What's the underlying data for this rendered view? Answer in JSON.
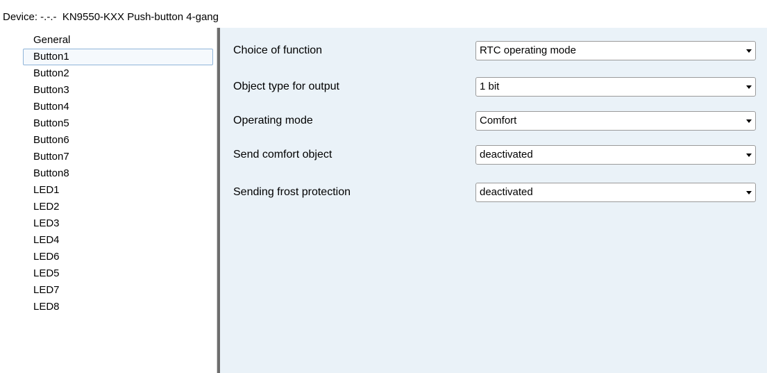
{
  "window": {
    "title": "Device: -.-.-  KN9550-KXX Push-button 4-gang"
  },
  "sidebar": {
    "items": [
      {
        "label": "General"
      },
      {
        "label": "Button1",
        "selected": true
      },
      {
        "label": "Button2"
      },
      {
        "label": "Button3"
      },
      {
        "label": "Button4"
      },
      {
        "label": "Button5"
      },
      {
        "label": "Button6"
      },
      {
        "label": "Button7"
      },
      {
        "label": "Button8"
      },
      {
        "label": "LED1"
      },
      {
        "label": "LED2"
      },
      {
        "label": "LED3"
      },
      {
        "label": "LED4"
      },
      {
        "label": "LED6"
      },
      {
        "label": "LED5"
      },
      {
        "label": "LED7"
      },
      {
        "label": "LED8"
      }
    ]
  },
  "parameters": [
    {
      "label": "Choice of function",
      "value": "RTC operating mode"
    },
    {
      "label": "Object type for output",
      "value": "1 bit"
    },
    {
      "label": "Operating mode",
      "value": "Comfort"
    },
    {
      "label": "Send comfort object",
      "value": "deactivated"
    },
    {
      "label": "Sending frost protection",
      "value": "deactivated"
    }
  ],
  "icons": {
    "dropdown": "chevron-down-icon"
  }
}
